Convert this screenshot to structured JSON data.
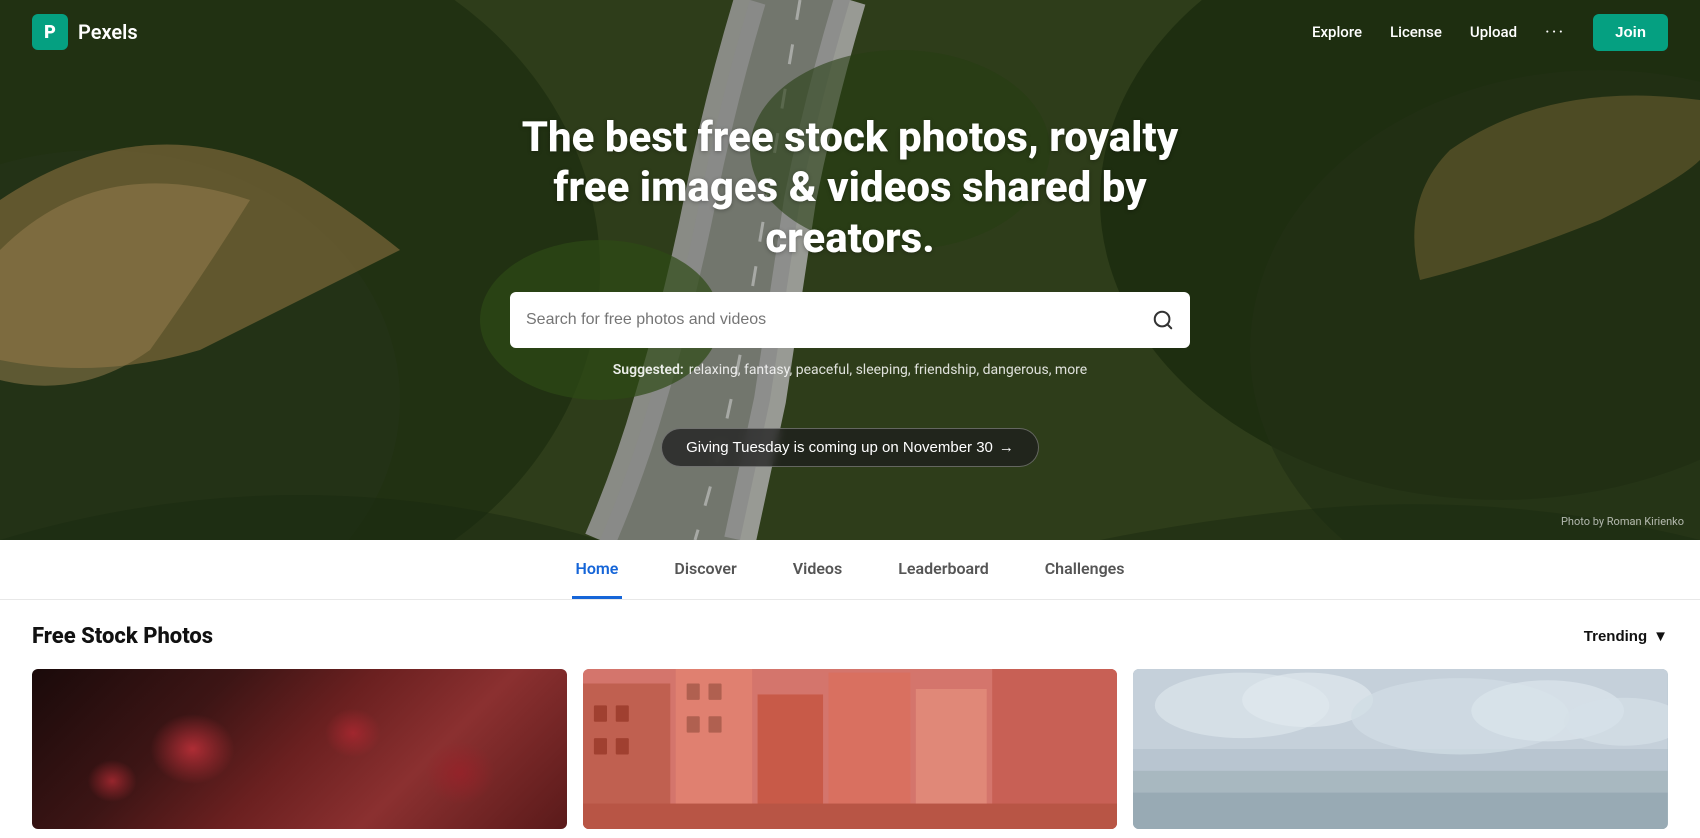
{
  "navbar": {
    "logo_letter": "P",
    "brand_name": "Pexels",
    "links": [
      {
        "label": "Explore",
        "name": "explore-link"
      },
      {
        "label": "License",
        "name": "license-link"
      },
      {
        "label": "Upload",
        "name": "upload-link"
      }
    ],
    "dots": "···",
    "join_label": "Join"
  },
  "hero": {
    "title": "The best free stock photos, royalty free images & videos shared by creators.",
    "search_placeholder": "Search for free photos and videos",
    "suggested_label": "Suggested:",
    "suggested_terms": "relaxing, fantasy, peaceful, sleeping, friendship, dangerous, more",
    "banner_text": "Giving Tuesday is coming up on November 30",
    "banner_arrow": "→",
    "photo_credit": "Photo by Roman Kirienko"
  },
  "tabs": [
    {
      "label": "Home",
      "active": true
    },
    {
      "label": "Discover",
      "active": false
    },
    {
      "label": "Videos",
      "active": false
    },
    {
      "label": "Leaderboard",
      "active": false
    },
    {
      "label": "Challenges",
      "active": false
    }
  ],
  "section": {
    "title": "Free Stock Photos",
    "sort_label": "Trending",
    "sort_arrow": "▼"
  },
  "colors": {
    "brand": "#05a081",
    "active_tab": "#1565d8"
  }
}
